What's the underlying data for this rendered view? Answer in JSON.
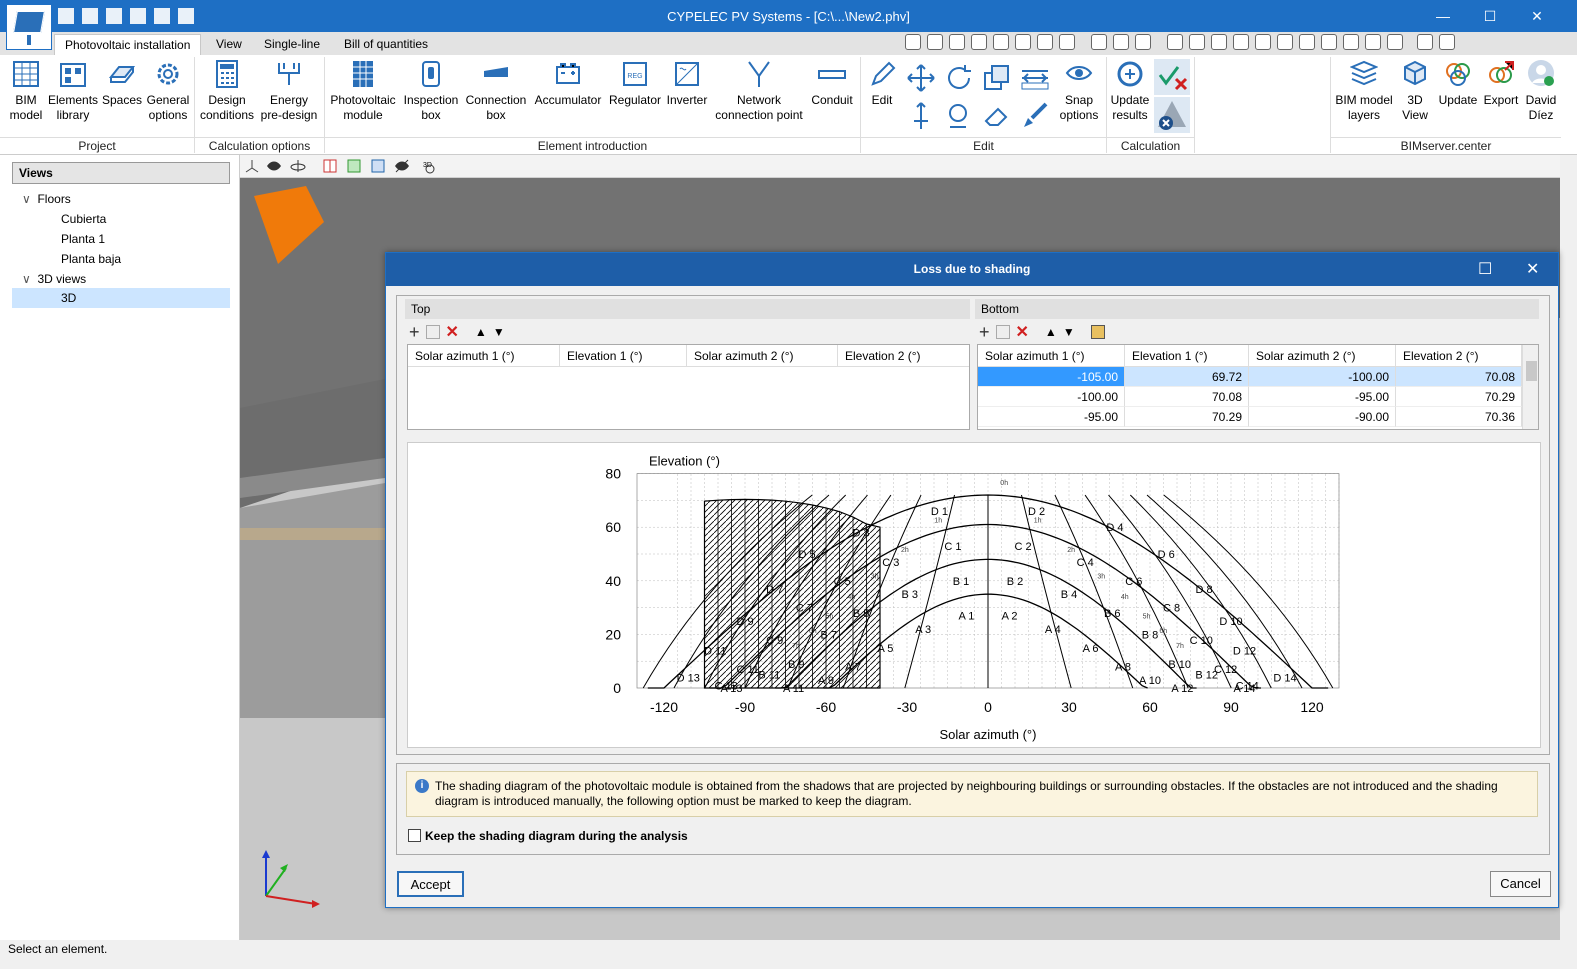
{
  "app": {
    "title": "CYPELEC PV Systems - [C:\\...\\New2.phv]",
    "status": "Select an element."
  },
  "tabs": [
    "Photovoltaic installation",
    "View",
    "Single-line",
    "Bill of quantities"
  ],
  "ribbon": {
    "buttons": [
      {
        "label": "BIM\nmodel"
      },
      {
        "label": "Elements\nlibrary"
      },
      {
        "label": "Spaces"
      },
      {
        "label": "General\noptions"
      },
      {
        "label": "Design\nconditions"
      },
      {
        "label": "Energy\npre-design"
      },
      {
        "label": "Photovoltaic\nmodule"
      },
      {
        "label": "Inspection\nbox"
      },
      {
        "label": "Connection\nbox"
      },
      {
        "label": "Accumulator"
      },
      {
        "label": "Regulator"
      },
      {
        "label": "Inverter"
      },
      {
        "label": "Network\nconnection point"
      },
      {
        "label": "Conduit"
      },
      {
        "label": "Edit"
      },
      {
        "label": "Snap\noptions"
      },
      {
        "label": "Update\nresults"
      },
      {
        "label": "BIM model\nlayers"
      },
      {
        "label": "3D\nView"
      },
      {
        "label": "Update"
      },
      {
        "label": "Export"
      },
      {
        "label": "David\nDíez"
      }
    ],
    "groups": [
      "Project",
      "Calculation options",
      "Element introduction",
      "Edit",
      "Calculation",
      "BIMserver.center"
    ]
  },
  "views": {
    "header": "Views",
    "floors_label": "Floors",
    "floors": [
      "Cubierta",
      "Planta 1",
      "Planta baja"
    ],
    "views3d_label": "3D views",
    "views3d": [
      "3D"
    ]
  },
  "dialog": {
    "title": "Loss due to shading",
    "top": {
      "label": "Top",
      "columns": [
        "Solar azimuth 1 (°)",
        "Elevation 1 (°)",
        "Solar azimuth 2 (°)",
        "Elevation 2 (°)"
      ],
      "rows": []
    },
    "bottom": {
      "label": "Bottom",
      "columns": [
        "Solar azimuth 1 (°)",
        "Elevation 1 (°)",
        "Solar azimuth 2 (°)",
        "Elevation 2 (°)"
      ],
      "rows": [
        [
          "-105.00",
          "69.72",
          "-100.00",
          "70.08"
        ],
        [
          "-100.00",
          "70.08",
          "-95.00",
          "70.29"
        ],
        [
          "-95.00",
          "70.29",
          "-90.00",
          "70.36"
        ]
      ]
    },
    "info": "The shading diagram of the photovoltaic module is obtained from the shadows that are projected by neighbouring buildings or surrounding obstacles. If the obstacles are not introduced and the shading diagram is introduced manually, the following option must be marked to keep the diagram.",
    "checkbox": "Keep the shading diagram during the analysis",
    "accept": "Accept",
    "cancel": "Cancel"
  },
  "chart_data": {
    "type": "diagram",
    "xlabel": "Solar azimuth (°)",
    "ylabel": "Elevation (°)",
    "xticks": [
      -120,
      -90,
      -60,
      -30,
      0,
      30,
      60,
      90,
      120
    ],
    "yticks": [
      0,
      20,
      40,
      60,
      80
    ],
    "xlim": [
      -120,
      130
    ],
    "ylim": [
      0,
      80
    ],
    "hour_labels": [
      "7h",
      "6h",
      "5h",
      "4h",
      "3h",
      "2h",
      "1h",
      "0h",
      "1h",
      "2h",
      "3h",
      "4h",
      "5h",
      "6h",
      "7h"
    ],
    "zones": [
      "A 1",
      "A 2",
      "A 3",
      "A 4",
      "A 5",
      "A 6",
      "A 7",
      "A 8",
      "A 9",
      "A 10",
      "A 11",
      "A 12",
      "A 13",
      "A 14",
      "B 1",
      "B 2",
      "B 3",
      "B 4",
      "B 5",
      "B 6",
      "B 7",
      "B 8",
      "B 9",
      "B 10",
      "B 11",
      "B 12",
      "C 1",
      "C 2",
      "C 3",
      "C 4",
      "C 5",
      "C 6",
      "C 7",
      "C 8",
      "C 9",
      "C 10",
      "C 11",
      "C 12",
      "C 13",
      "C 14",
      "D 1",
      "D 2",
      "D 3",
      "D 4",
      "D 5",
      "D 6",
      "D 7",
      "D 8",
      "D 9",
      "D 10",
      "D 11",
      "D 12",
      "D 13",
      "D 14"
    ],
    "shading_profile": [
      [
        -105,
        69.72
      ],
      [
        -100,
        70.08
      ],
      [
        -95,
        70.29
      ],
      [
        -90,
        70.36
      ],
      [
        -85,
        70.3
      ],
      [
        -80,
        70.1
      ],
      [
        -75,
        69.7
      ],
      [
        -70,
        69.1
      ],
      [
        -65,
        68.3
      ],
      [
        -60,
        67.2
      ],
      [
        -55,
        65.8
      ],
      [
        -50,
        63.8
      ],
      [
        -45,
        61.2
      ],
      [
        -40,
        60
      ]
    ]
  }
}
